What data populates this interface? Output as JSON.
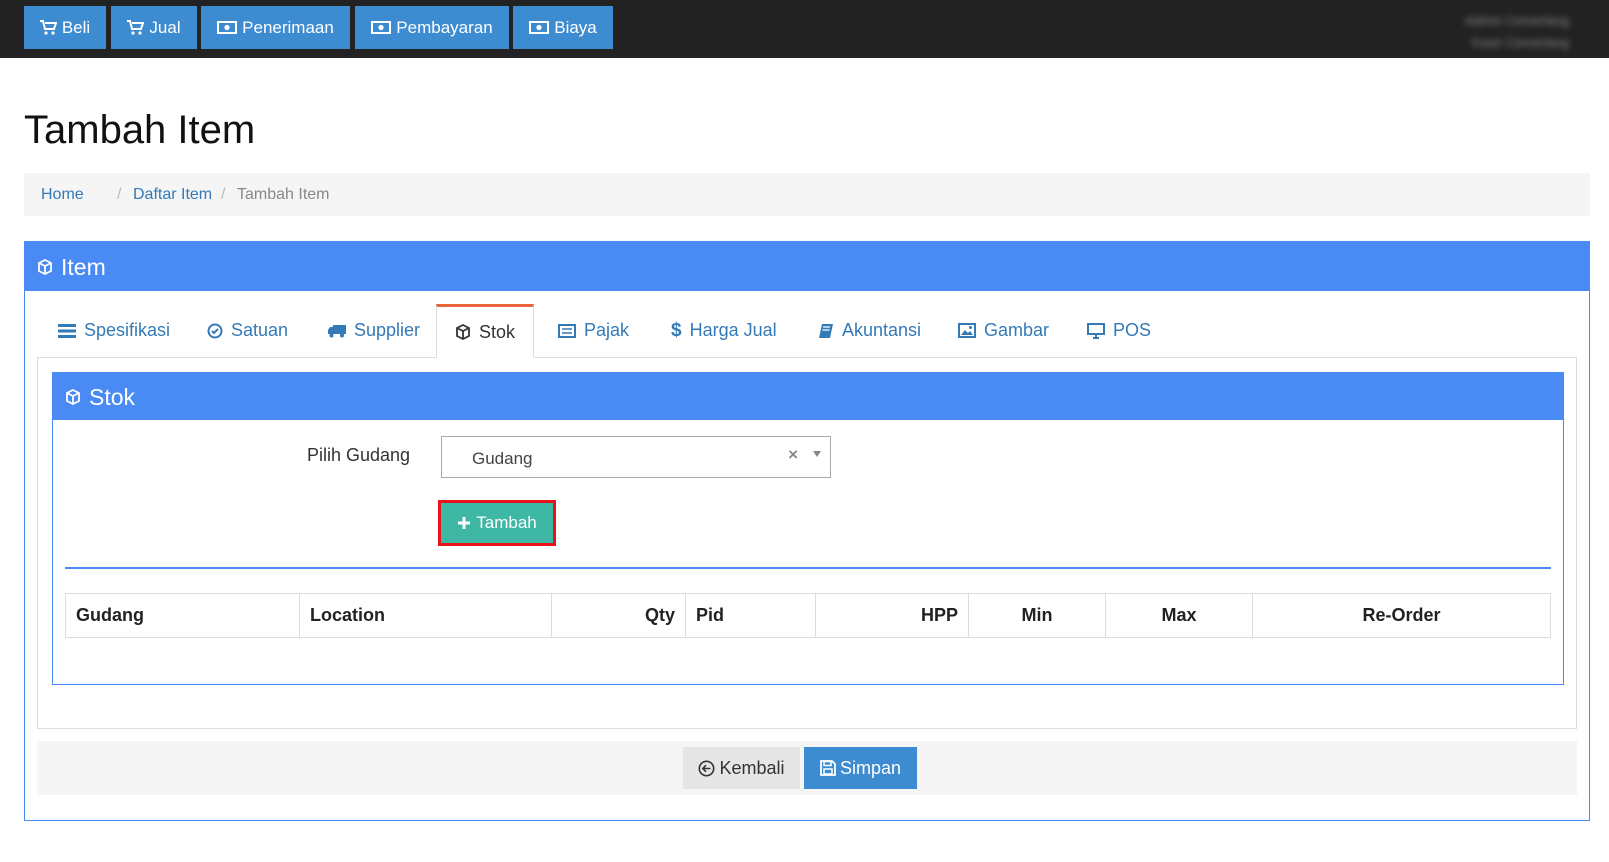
{
  "topbar": {
    "buttons": [
      {
        "label": "Beli",
        "icon": "cart-icon"
      },
      {
        "label": "Jual",
        "icon": "cart-icon"
      },
      {
        "label": "Penerimaan",
        "icon": "money-icon"
      },
      {
        "label": "Pembayaran",
        "icon": "money-icon"
      },
      {
        "label": "Biaya",
        "icon": "money-icon"
      }
    ],
    "user_line1": "Admin Cemerlang",
    "user_line2": "Kasir Cemerlang"
  },
  "page": {
    "title": "Tambah Item"
  },
  "breadcrumb": {
    "home": "Home",
    "list": "Daftar Item",
    "current": "Tambah Item",
    "separator": "/"
  },
  "panel": {
    "title": "Item",
    "icon": "cube-icon"
  },
  "tabs": [
    {
      "label": "Spesifikasi",
      "icon": "list-icon"
    },
    {
      "label": "Satuan",
      "icon": "check-circle-icon"
    },
    {
      "label": "Supplier",
      "icon": "truck-icon"
    },
    {
      "label": "Stok",
      "icon": "cube-icon",
      "active": true
    },
    {
      "label": "Pajak",
      "icon": "list-alt-icon"
    },
    {
      "label": "Harga Jual",
      "icon": "dollar-icon"
    },
    {
      "label": "Akuntansi",
      "icon": "book-icon"
    },
    {
      "label": "Gambar",
      "icon": "image-icon"
    },
    {
      "label": "POS",
      "icon": "monitor-icon"
    }
  ],
  "stok": {
    "title": "Stok",
    "form": {
      "label": "Pilih Gudang",
      "selected": "Gudang",
      "clear": "×"
    },
    "add_button": "Tambah",
    "table_headers": [
      "Gudang",
      "Location",
      "Qty",
      "Pid",
      "HPP",
      "Min",
      "Max",
      "Re-Order"
    ]
  },
  "footer": {
    "back": "Kembali",
    "save": "Simpan"
  },
  "colors": {
    "primary": "#4a8af4",
    "topbar": "#222222",
    "button_blue": "#3d8bd0",
    "button_teal": "#3fb7a5",
    "highlight": "#e8131b",
    "active_tab": "#e9663d"
  }
}
